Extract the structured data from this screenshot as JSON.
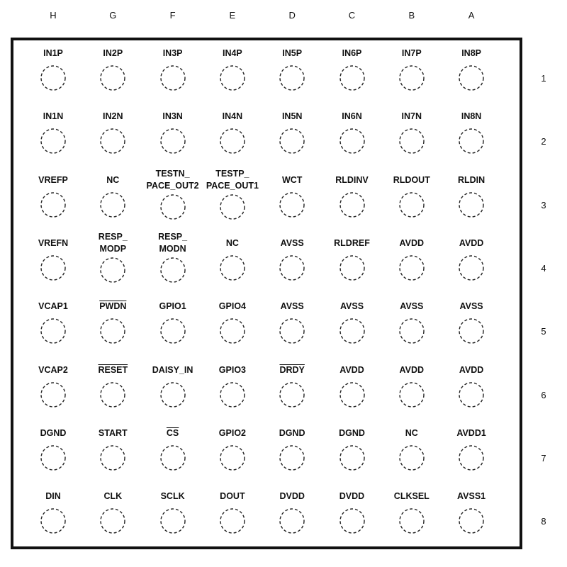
{
  "columns": [
    "H",
    "G",
    "F",
    "E",
    "D",
    "C",
    "B",
    "A"
  ],
  "rows": [
    "1",
    "2",
    "3",
    "4",
    "5",
    "6",
    "7",
    "8"
  ],
  "grid": [
    [
      {
        "name": "IN1P"
      },
      {
        "name": "IN2P"
      },
      {
        "name": "IN3P"
      },
      {
        "name": "IN4P"
      },
      {
        "name": "IN5P"
      },
      {
        "name": "IN6P"
      },
      {
        "name": "IN7P"
      },
      {
        "name": "IN8P"
      }
    ],
    [
      {
        "name": "IN1N"
      },
      {
        "name": "IN2N"
      },
      {
        "name": "IN3N"
      },
      {
        "name": "IN4N"
      },
      {
        "name": "IN5N"
      },
      {
        "name": "IN6N"
      },
      {
        "name": "IN7N"
      },
      {
        "name": "IN8N"
      }
    ],
    [
      {
        "name": "VREFP"
      },
      {
        "name": "NC"
      },
      {
        "name": "TESTN_\nPACE_OUT2"
      },
      {
        "name": "TESTP_\nPACE_OUT1"
      },
      {
        "name": "WCT"
      },
      {
        "name": "RLDINV"
      },
      {
        "name": "RLDOUT"
      },
      {
        "name": "RLDIN"
      }
    ],
    [
      {
        "name": "VREFN"
      },
      {
        "name": "RESP_\nMODP"
      },
      {
        "name": "RESP_\nMODN"
      },
      {
        "name": "NC"
      },
      {
        "name": "AVSS"
      },
      {
        "name": "RLDREF"
      },
      {
        "name": "AVDD"
      },
      {
        "name": "AVDD"
      }
    ],
    [
      {
        "name": "VCAP1"
      },
      {
        "name": "PWDN",
        "active_low": true
      },
      {
        "name": "GPIO1"
      },
      {
        "name": "GPIO4"
      },
      {
        "name": "AVSS"
      },
      {
        "name": "AVSS"
      },
      {
        "name": "AVSS"
      },
      {
        "name": "AVSS"
      }
    ],
    [
      {
        "name": "VCAP2"
      },
      {
        "name": "RESET",
        "active_low": true
      },
      {
        "name": "DAISY_IN"
      },
      {
        "name": "GPIO3"
      },
      {
        "name": "DRDY",
        "active_low": true
      },
      {
        "name": "AVDD"
      },
      {
        "name": "AVDD"
      },
      {
        "name": "AVDD"
      }
    ],
    [
      {
        "name": "DGND"
      },
      {
        "name": "START"
      },
      {
        "name": "CS",
        "active_low": true
      },
      {
        "name": "GPIO2"
      },
      {
        "name": "DGND"
      },
      {
        "name": "DGND"
      },
      {
        "name": "NC"
      },
      {
        "name": "AVDD1"
      }
    ],
    [
      {
        "name": "DIN"
      },
      {
        "name": "CLK"
      },
      {
        "name": "SCLK"
      },
      {
        "name": "DOUT"
      },
      {
        "name": "DVDD"
      },
      {
        "name": "DVDD"
      },
      {
        "name": "CLKSEL"
      },
      {
        "name": "AVSS1"
      }
    ]
  ]
}
